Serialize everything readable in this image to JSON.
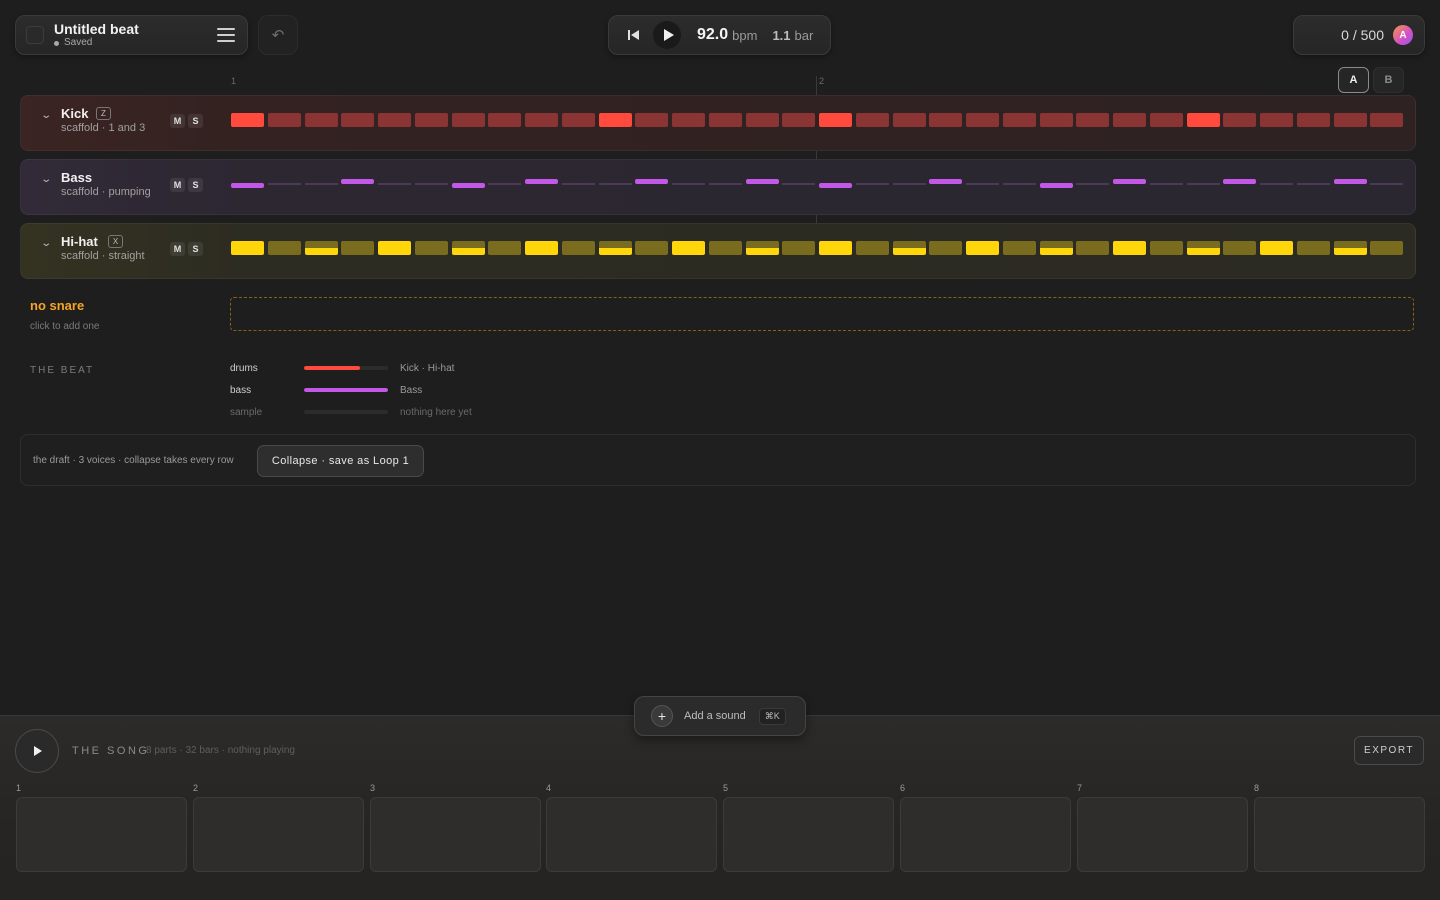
{
  "header": {
    "beat_title": "Untitled beat",
    "saved_status": "Saved",
    "undo_glyph": "↶"
  },
  "transport": {
    "bpm": "92.0",
    "bpm_unit": "bpm",
    "bar": "1.1",
    "bar_unit": "bar"
  },
  "counter": {
    "text": "0 / 500",
    "avatar_initial": "A"
  },
  "ruler": {
    "bar_1": "1",
    "bar_2": "2"
  },
  "ab_switch": {
    "a": "A",
    "b": "B"
  },
  "tracks": [
    {
      "id": "kick",
      "name": "Kick",
      "key": "Z",
      "subtitle": "scaffold · 1 and 3",
      "mute": "M",
      "solo": "S",
      "color": "#ff4a3d",
      "dim_color": "#8a3533",
      "style": "block",
      "steps": [
        1,
        0,
        0,
        0,
        0,
        0,
        0,
        0,
        0,
        0,
        1,
        0,
        0,
        0,
        0,
        0,
        1,
        0,
        0,
        0,
        0,
        0,
        0,
        0,
        0,
        0,
        1,
        0,
        0,
        0,
        0,
        0
      ]
    },
    {
      "id": "bass",
      "name": "Bass",
      "key": "",
      "subtitle": "scaffold · pumping",
      "mute": "M",
      "solo": "S",
      "color": "#c257e8",
      "dim_color": "#4a3a55",
      "style": "note",
      "notes": [
        "low",
        "off",
        "off",
        "high",
        "off",
        "off",
        "low",
        "off",
        "high",
        "off",
        "off",
        "high",
        "off",
        "off",
        "high",
        "off",
        "low",
        "off",
        "off",
        "high",
        "off",
        "off",
        "low",
        "off",
        "high",
        "off",
        "off",
        "high",
        "off",
        "off",
        "high",
        "off"
      ]
    },
    {
      "id": "hihat",
      "name": "Hi-hat",
      "key": "X",
      "subtitle": "scaffold · straight",
      "mute": "M",
      "solo": "S",
      "color": "#ffd60a",
      "dim_color": "#7a6c1e",
      "style": "hat",
      "levels": [
        "full",
        "off",
        "half",
        "off",
        "full",
        "off",
        "half",
        "off",
        "full",
        "off",
        "half",
        "off",
        "full",
        "off",
        "half",
        "off",
        "full",
        "off",
        "half",
        "off",
        "full",
        "off",
        "half",
        "off",
        "full",
        "off",
        "half",
        "off",
        "full",
        "off",
        "half",
        "off"
      ]
    }
  ],
  "snare": {
    "title": "no snare",
    "hint": "click to add one"
  },
  "the_beat": {
    "label": "THE BEAT",
    "rows": [
      {
        "name": "drums",
        "fill": 0.67,
        "color": "#ff4a3d",
        "desc": "Kick · Hi-hat"
      },
      {
        "name": "bass",
        "fill": 1.0,
        "color": "#c257e8",
        "desc": "Bass"
      },
      {
        "name": "sample",
        "fill": 0,
        "color": "#555555",
        "desc": "nothing here yet"
      }
    ]
  },
  "draft": {
    "text": "the draft · 3 voices · collapse takes every row",
    "collapse_label": "Collapse · save as Loop 1"
  },
  "add_sound": {
    "label": "Add a sound",
    "shortcut": "⌘K",
    "plus": "+"
  },
  "song": {
    "title": "THE SONG",
    "meta": "8 parts · 32 bars · nothing playing",
    "export_label": "EXPORT",
    "parts": [
      "1",
      "2",
      "3",
      "4",
      "5",
      "6",
      "7",
      "8"
    ]
  }
}
